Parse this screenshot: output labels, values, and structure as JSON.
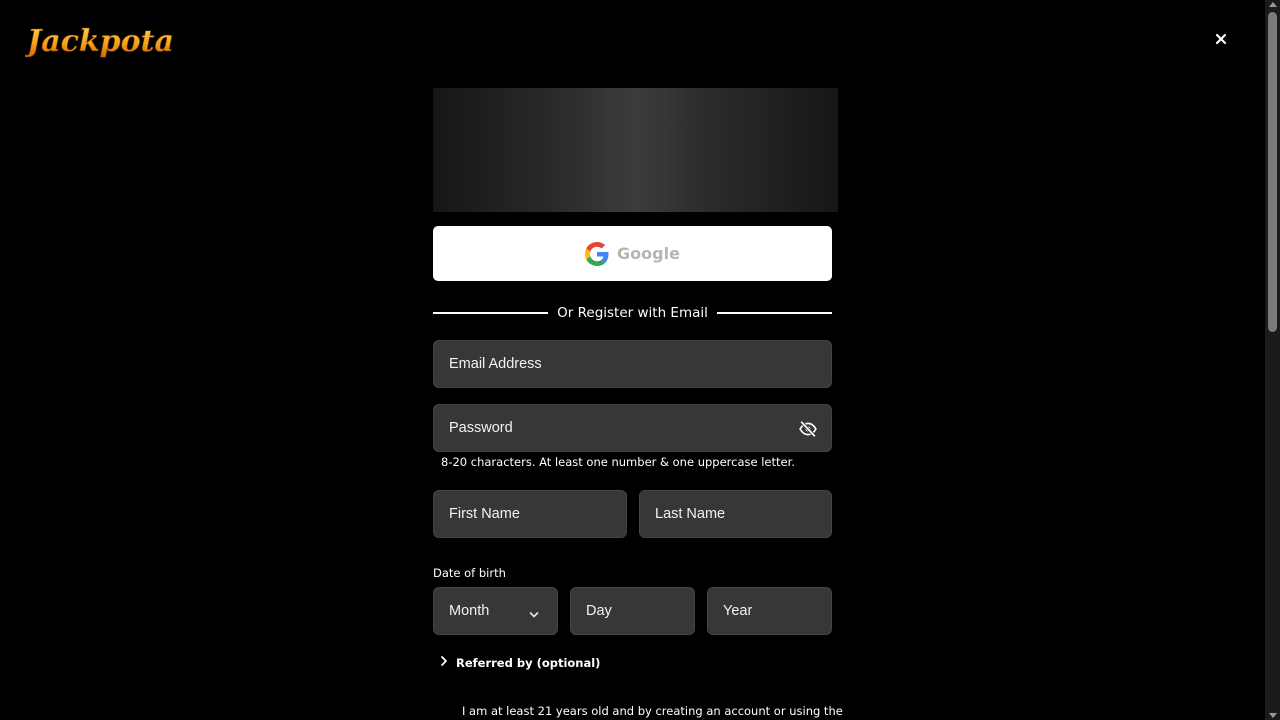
{
  "brand": {
    "name": "Jackpota",
    "accent": "#f5a21b",
    "accent_dark": "#c9620b"
  },
  "icons": {
    "close": "close-icon",
    "google": "google-g-icon",
    "eye": "eye-slash-icon",
    "chevron_down": "chevron-down-icon",
    "chevron_right": "chevron-right-icon"
  },
  "social": {
    "google_label": "Google"
  },
  "divider": {
    "text": "Or Register with Email"
  },
  "form": {
    "email_placeholder": "Email Address",
    "password_placeholder": "Password",
    "password_hint": "8-20 characters. At least one number & one uppercase letter.",
    "first_name_placeholder": "First Name",
    "last_name_placeholder": "Last Name",
    "dob_label": "Date of birth",
    "month_placeholder": "Month",
    "day_placeholder": "Day",
    "year_placeholder": "Year",
    "referred_label": "Referred by (optional)",
    "terms_text": "I am at least 21 years old and by creating an account or using the"
  }
}
